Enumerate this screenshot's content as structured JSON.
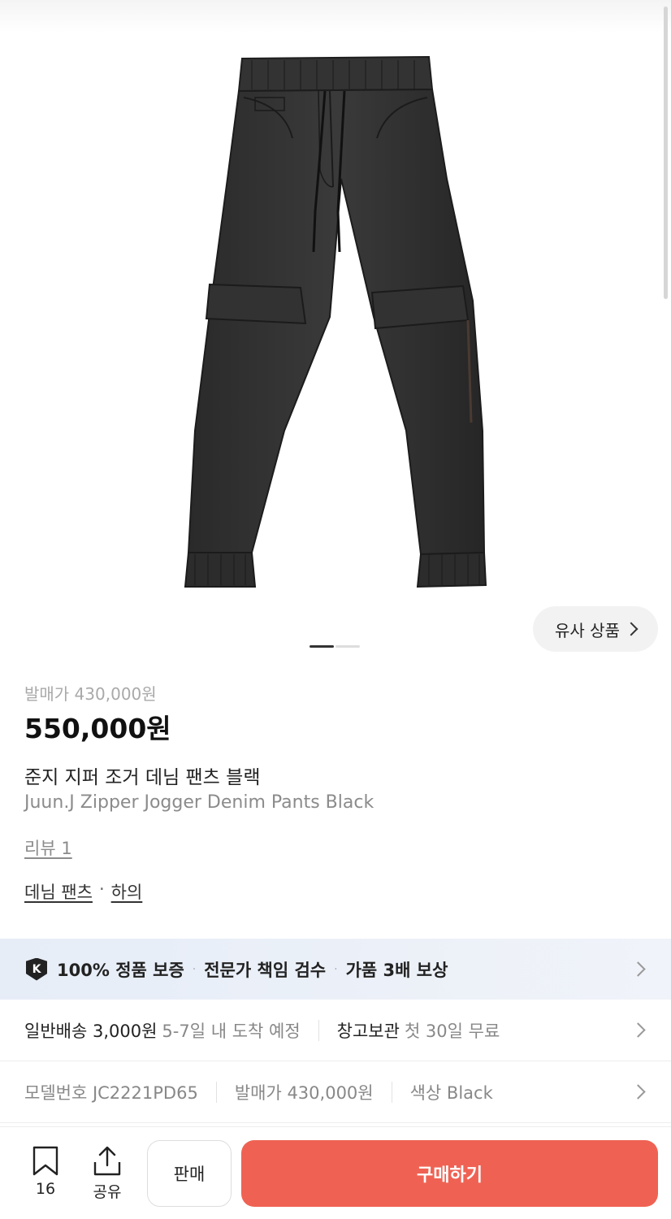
{
  "gallery": {
    "similar_label": "유사 상품",
    "slide_count": 2,
    "active_slide": 1
  },
  "product": {
    "release_price_text": "발매가 430,000원",
    "price": "550,000원",
    "name_ko": "준지 지퍼 조거 데님 팬츠 블랙",
    "name_en": "Juun.J Zipper Jogger Denim Pants Black",
    "review": "리뷰 1",
    "category_1": "데님 팬츠",
    "category_sep": "·",
    "category_2": "하의"
  },
  "guarantee": {
    "badge": "K",
    "item_1": "100% 정품 보증",
    "item_2": "전문가 책임 검수",
    "item_3": "가품 3배 보상",
    "sep": "·"
  },
  "shipping": {
    "normal_label": "일반배송 3,000원",
    "normal_detail": "5-7일 내 도착 예정",
    "warehouse_label": "창고보관",
    "warehouse_detail": "첫 30일 무료"
  },
  "specs": {
    "model": "모델번호 JC2221PD65",
    "release": "발매가 430,000원",
    "color": "색상 Black"
  },
  "bottom": {
    "bookmark_count": "16",
    "share_label": "공유",
    "sell_label": "판매",
    "buy_label": "구매하기"
  },
  "colors": {
    "buy_button": "#ef6253",
    "guarantee_bg": "#e6edf7"
  }
}
